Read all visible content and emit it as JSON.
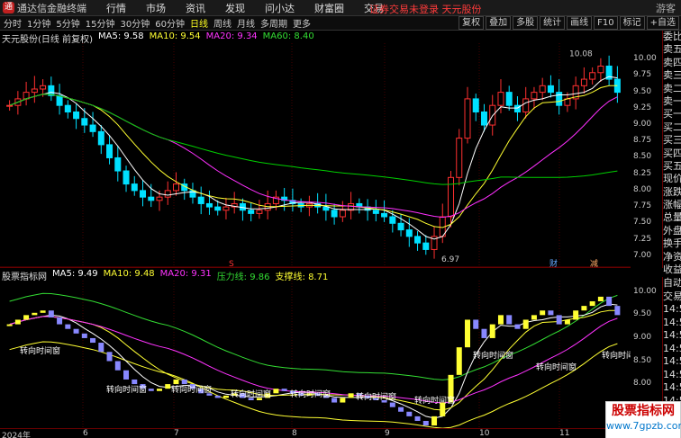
{
  "titlebar": {
    "app_name": "通达信金融终端",
    "menus": [
      "行情",
      "市场",
      "资讯",
      "发现",
      "问小达",
      "财富圈",
      "交易"
    ],
    "login_text": "证券交易未登录  天元股份",
    "guest": "游客"
  },
  "toolbar": {
    "periods": [
      "分时",
      "1分钟",
      "5分钟",
      "15分钟",
      "30分钟",
      "60分钟",
      "日线",
      "周线",
      "月线",
      "多周期",
      "更多"
    ],
    "active_period": "日线",
    "tools": [
      "复权",
      "叠加",
      "多股",
      "统计",
      "画线",
      "F10",
      "标记",
      "+自选"
    ]
  },
  "main_legend": {
    "stock": "天元股份(日线 前复权)",
    "ma5": "MA5: 9.58",
    "ma10": "MA10: 9.54",
    "ma20": "MA20: 9.34",
    "ma60": "MA60: 8.40"
  },
  "sub_legend": {
    "name": "股票指标网",
    "ma5": "MA5: 9.49",
    "ma10": "MA10: 9.48",
    "ma20": "MA20: 9.31",
    "pressure": "压力线: 9.86",
    "support": "支撑线: 8.71"
  },
  "price_axis": [
    "10.00",
    "9.75",
    "9.50",
    "9.25",
    "9.00",
    "8.75",
    "8.50",
    "8.25",
    "8.00",
    "7.75",
    "7.50",
    "7.25",
    "7.00"
  ],
  "sub_axis": [
    "10.00",
    "9.50",
    "9.00",
    "8.50",
    "8.00",
    "7.50"
  ],
  "annotations": {
    "high": "10.08",
    "low": "6.97",
    "marker_cai": "财",
    "marker_jian": "减",
    "marker_s": "S",
    "turn_label": "转向时间窗"
  },
  "right_panel": [
    "委比",
    "卖五",
    "卖四",
    "卖三",
    "卖二",
    "卖一",
    "买一",
    "买二",
    "买三",
    "买四",
    "买五",
    "现价",
    "涨跌",
    "涨幅",
    "总量",
    "外盘",
    "换手",
    "净资",
    "收益"
  ],
  "right_panel2": [
    "自动",
    "交易",
    "14:5",
    "14:5",
    "14:5",
    "14:5",
    "14:5",
    "14:5",
    "14:5",
    "14:5",
    "14:5",
    "14:5"
  ],
  "date_axis": [
    "2024年",
    "6",
    "7",
    "8",
    "9",
    "10",
    "11"
  ],
  "watermark": {
    "title": "股票指标网",
    "url": "www.7gpzb.com"
  },
  "colors": {
    "up": "#ff3030",
    "down": "#00e0ff",
    "ma5": "#ffffff",
    "ma10": "#ffff30",
    "ma20": "#ff30ff",
    "ma60": "#00d000"
  },
  "chart_data": {
    "type": "candlestick",
    "close": [
      9.3,
      9.4,
      9.5,
      9.55,
      9.6,
      9.45,
      9.3,
      9.2,
      9.1,
      9.0,
      8.9,
      8.7,
      8.5,
      8.3,
      8.1,
      8.0,
      7.9,
      7.85,
      7.9,
      8.0,
      8.1,
      8.0,
      7.9,
      7.8,
      7.75,
      7.7,
      7.75,
      7.8,
      7.7,
      7.65,
      7.7,
      7.8,
      7.9,
      7.85,
      7.8,
      7.75,
      7.8,
      7.75,
      7.7,
      7.6,
      7.7,
      7.8,
      7.75,
      7.7,
      7.65,
      7.6,
      7.5,
      7.4,
      7.3,
      7.2,
      7.1,
      7.3,
      7.6,
      8.2,
      8.8,
      9.4,
      9.2,
      9.0,
      9.3,
      9.5,
      9.3,
      9.2,
      9.4,
      9.5,
      9.6,
      9.5,
      9.3,
      9.4,
      9.6,
      9.7,
      9.8,
      9.9,
      9.7,
      9.5
    ]
  }
}
